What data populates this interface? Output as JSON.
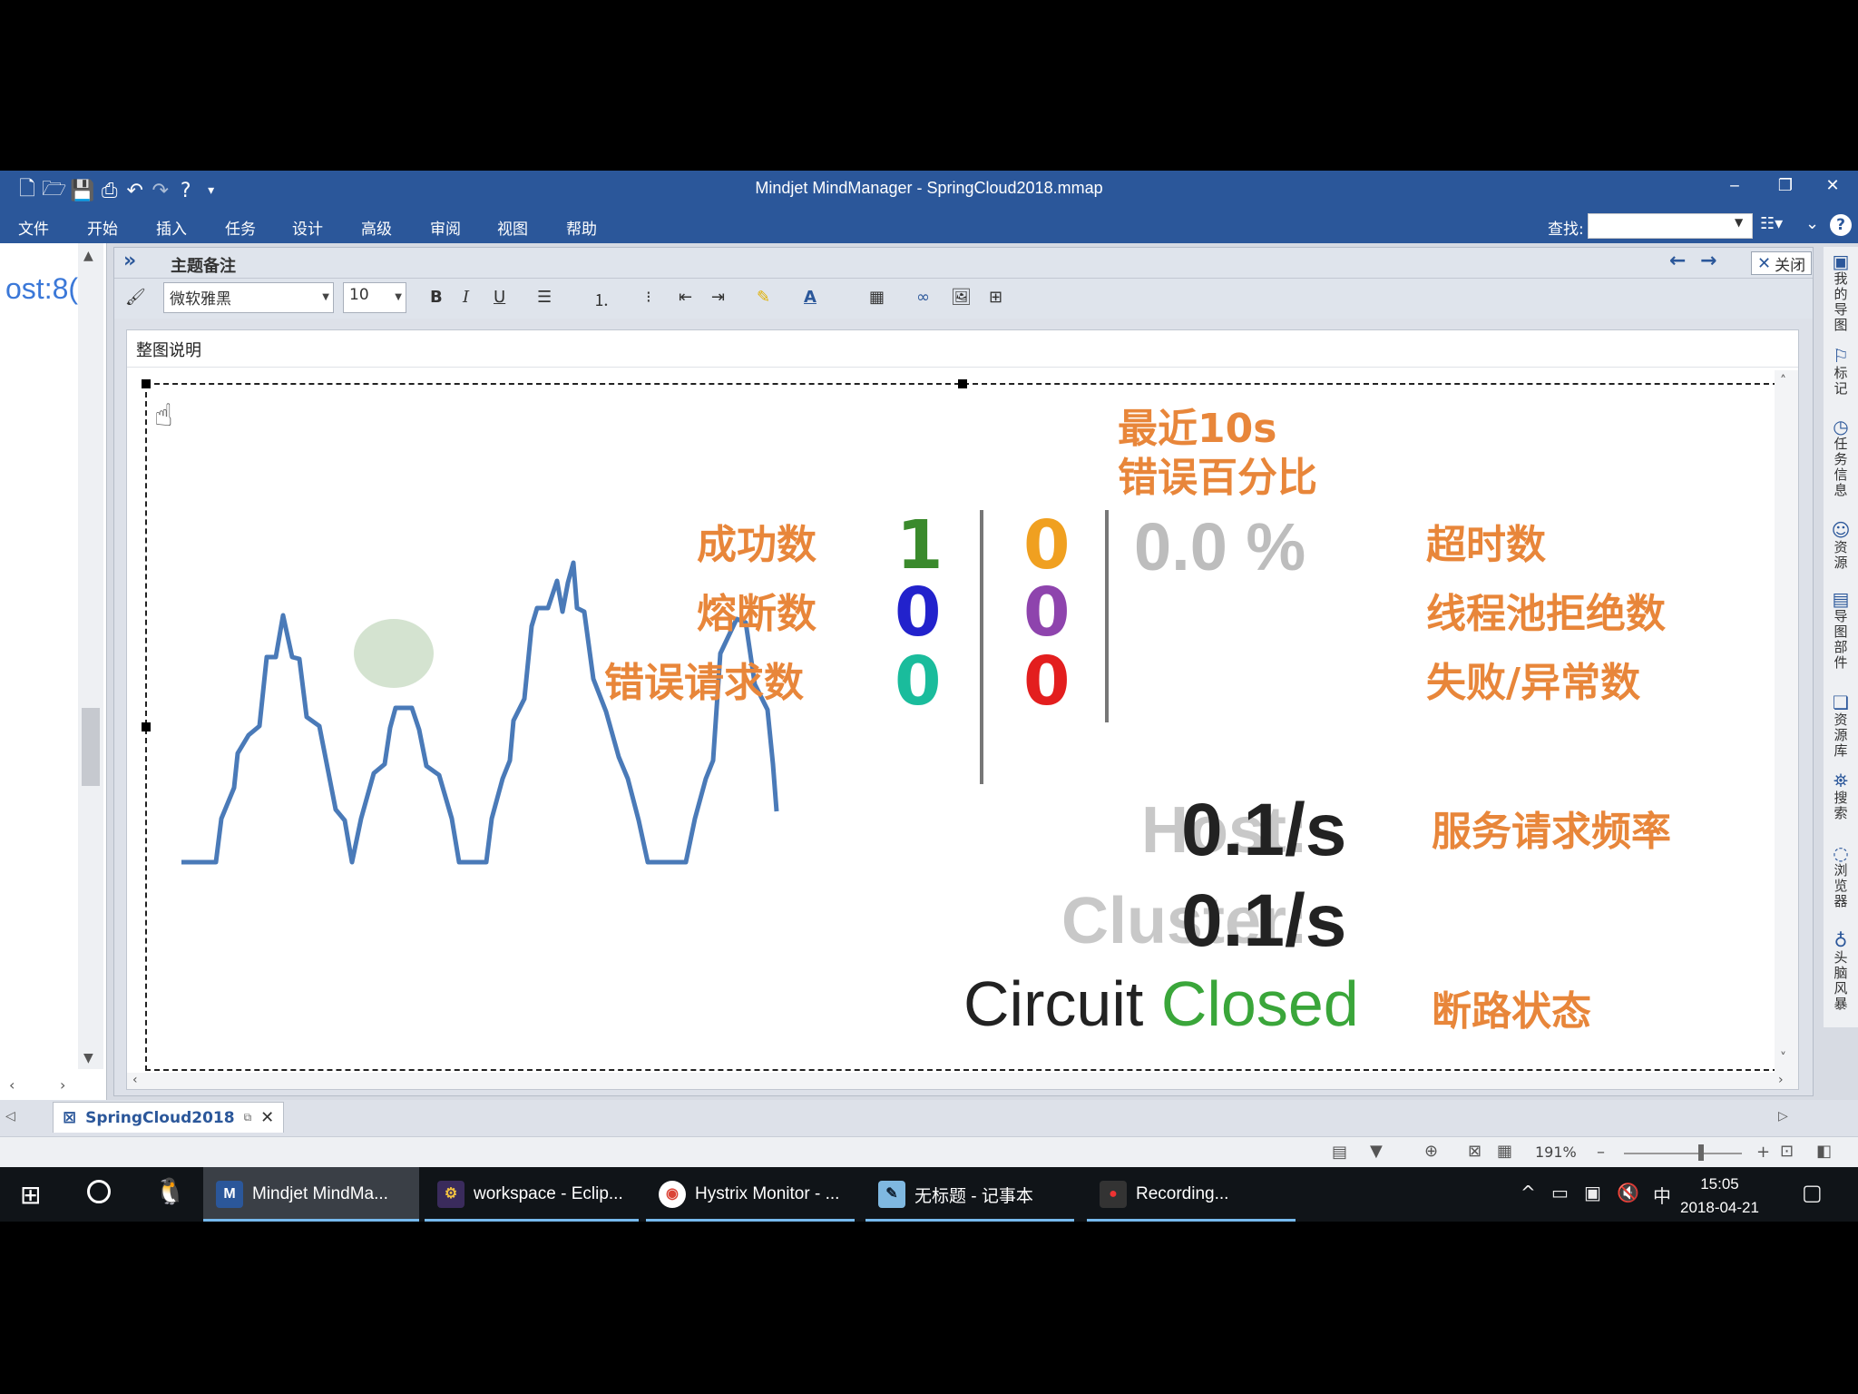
{
  "window": {
    "title": "Mindjet MindManager - SpringCloud2018.mmap",
    "minimize": "‒",
    "restore": "❐",
    "close": "✕"
  },
  "menu": {
    "items": [
      "文件",
      "开始",
      "插入",
      "任务",
      "设计",
      "高级",
      "审阅",
      "视图",
      "帮助"
    ],
    "search_label": "查找:",
    "search_value": ""
  },
  "left_pane": {
    "text_fragment": "ost:8("
  },
  "notes": {
    "title": "主题备注",
    "close_label": "关闭",
    "font": "微软雅黑",
    "size": "10",
    "caption": "整图说明"
  },
  "hystrix_image": {
    "labels_left": [
      "成功数",
      "熔断数",
      "错误请求数"
    ],
    "col1_counts": [
      "1",
      "0",
      "0"
    ],
    "col2_counts": [
      "0",
      "0",
      "0"
    ],
    "error_pct_label_line1": "最近10s",
    "error_pct_label_line2": "错误百分比",
    "error_pct_value": "0.0 %",
    "labels_right": [
      "超时数",
      "线程池拒绝数",
      "失败/异常数"
    ],
    "host_label": "Host:",
    "host_value": "0.1/s",
    "cluster_label": "Cluster:",
    "cluster_value": "0.1/s",
    "rate_note": "服务请求频率",
    "circuit_label": "Circuit",
    "circuit_value": "Closed",
    "circuit_note": "断路状态",
    "colors": {
      "orange": "#e8863a",
      "green": "#3a8a2c",
      "blue": "#2222cc",
      "teal": "#1abc9c",
      "yellow": "#f0a020",
      "purple": "#8e44ad",
      "red": "#e31e1e",
      "closed_green": "#3aa63a",
      "line_blue": "#4a7ab8"
    }
  },
  "right_tabs": [
    "我的导图",
    "标记",
    "任务信息",
    "资源",
    "导图部件",
    "资源库",
    "搜索",
    "浏览器",
    "头脑风暴"
  ],
  "doc_tab": {
    "name": "SpringCloud2018"
  },
  "status": {
    "zoom": "191%"
  },
  "taskbar": {
    "tasks": [
      {
        "label": "Mindjet MindMa...",
        "icon": "mindjet-icon"
      },
      {
        "label": "workspace - Eclip...",
        "icon": "eclipse-icon"
      },
      {
        "label": "Hystrix Monitor - ...",
        "icon": "chrome-icon"
      },
      {
        "label": "无标题 - 记事本",
        "icon": "notepad-icon"
      },
      {
        "label": "Recording...",
        "icon": "recorder-icon"
      }
    ],
    "ime": "中",
    "time": "15:05",
    "date": "2018-04-21"
  }
}
